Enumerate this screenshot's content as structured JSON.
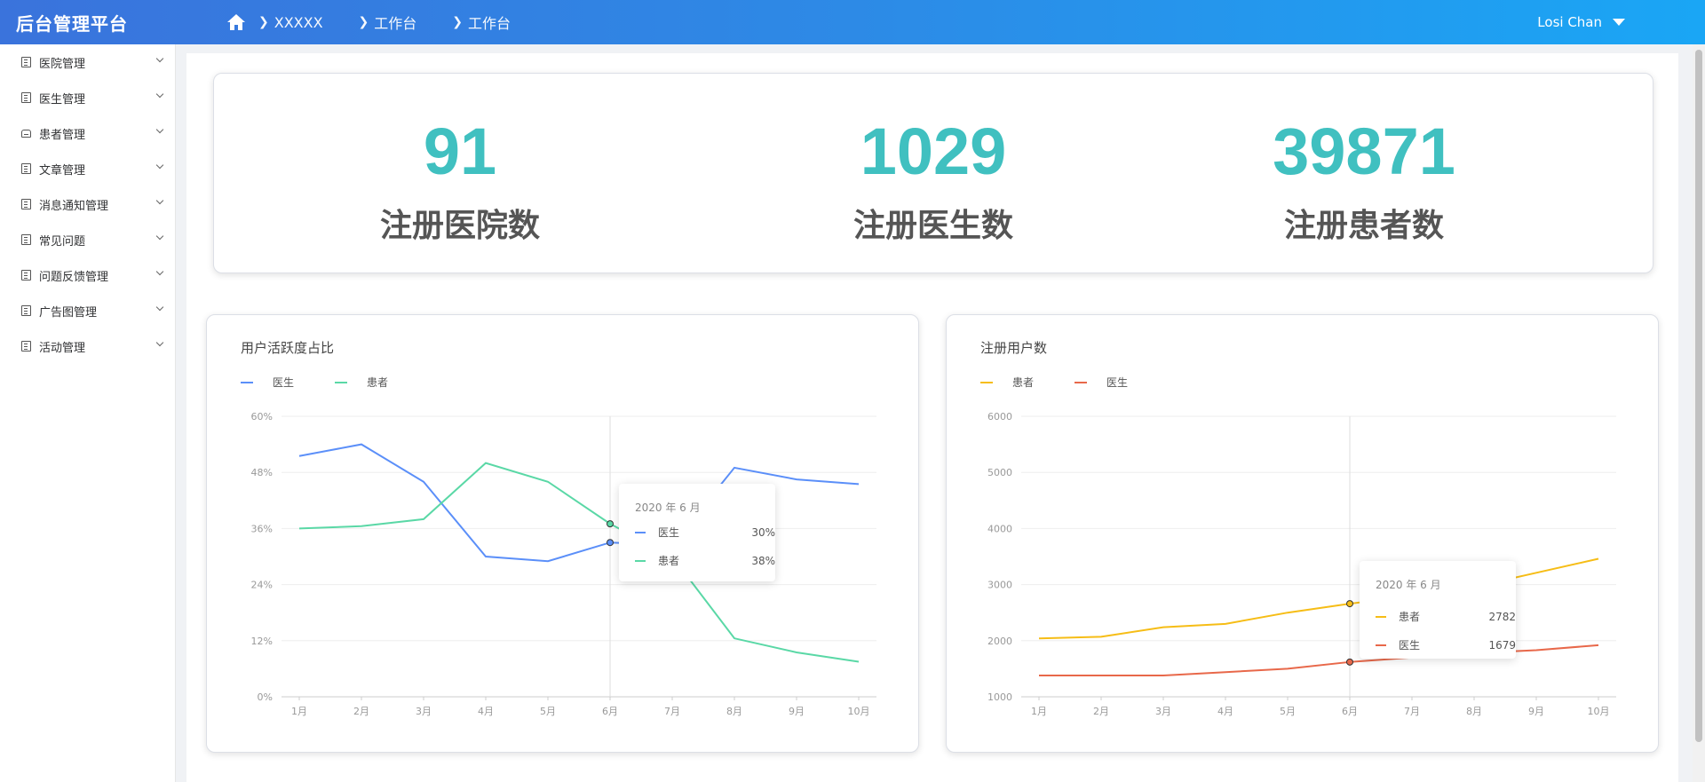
{
  "app": {
    "title": "后台管理平台"
  },
  "breadcrumb": [
    "XXXXX",
    "工作台",
    "工作台"
  ],
  "user": {
    "name": "Losi Chan"
  },
  "sidebar": {
    "items": [
      {
        "label": "医院管理",
        "icon": "building-icon"
      },
      {
        "label": "医生管理",
        "icon": "building-icon"
      },
      {
        "label": "患者管理",
        "icon": "tray-icon"
      },
      {
        "label": "文章管理",
        "icon": "building-icon"
      },
      {
        "label": "消息通知管理",
        "icon": "building-icon"
      },
      {
        "label": "常见问题",
        "icon": "building-icon"
      },
      {
        "label": "问题反馈管理",
        "icon": "building-icon"
      },
      {
        "label": "广告图管理",
        "icon": "building-icon"
      },
      {
        "label": "活动管理",
        "icon": "building-icon"
      }
    ]
  },
  "stats": [
    {
      "value": "91",
      "label": "注册医院数"
    },
    {
      "value": "1029",
      "label": "注册医生数"
    },
    {
      "value": "39871",
      "label": "注册患者数"
    }
  ],
  "colors": {
    "accent": "#40c0c0",
    "doctor_blue": "#5b8ff9",
    "patient_green": "#5ad8a6",
    "patient_yellow": "#f6bd16",
    "doctor_red": "#e8684a"
  },
  "chart_data": [
    {
      "type": "line",
      "title": "用户活跃度占比",
      "categories": [
        "1月",
        "2月",
        "3月",
        "4月",
        "5月",
        "6月",
        "7月",
        "8月",
        "9月",
        "10月"
      ],
      "series": [
        {
          "name": "医生",
          "color": "#5b8ff9",
          "values": [
            51.5,
            54,
            46,
            30,
            29,
            33,
            32.5,
            49,
            46.5,
            45.5
          ]
        },
        {
          "name": "患者",
          "color": "#5ad8a6",
          "values": [
            36,
            36.5,
            38,
            50,
            46,
            37,
            30,
            12.5,
            9.5,
            7.5
          ]
        }
      ],
      "ylim": [
        0,
        60
      ],
      "yticks": [
        "0%",
        "12%",
        "24%",
        "36%",
        "48%",
        "60%"
      ],
      "ystep": 12,
      "legend": "top-left",
      "tooltip": {
        "title": "2020 年 6 月",
        "index": 5,
        "rows": [
          {
            "name": "医生",
            "value": "30%"
          },
          {
            "name": "患者",
            "value": "38%"
          }
        ]
      }
    },
    {
      "type": "line",
      "title": "注册用户数",
      "categories": [
        "1月",
        "2月",
        "3月",
        "4月",
        "5月",
        "6月",
        "7月",
        "8月",
        "9月",
        "10月"
      ],
      "series": [
        {
          "name": "患者",
          "color": "#f6bd16",
          "values": [
            2040,
            2070,
            2240,
            2300,
            2500,
            2660,
            2800,
            2960,
            3210,
            3460
          ]
        },
        {
          "name": "医生",
          "color": "#e8684a",
          "values": [
            1380,
            1380,
            1380,
            1440,
            1500,
            1620,
            1700,
            1780,
            1830,
            1920
          ]
        }
      ],
      "ylim": [
        1000,
        6000
      ],
      "yticks": [
        "1000",
        "2000",
        "3000",
        "4000",
        "5000",
        "6000"
      ],
      "ystep": 1000,
      "legend": "top-left",
      "tooltip": {
        "title": "2020 年 6 月",
        "index": 5,
        "rows": [
          {
            "name": "患者",
            "value": "2782"
          },
          {
            "name": "医生",
            "value": "1679"
          }
        ]
      }
    }
  ]
}
